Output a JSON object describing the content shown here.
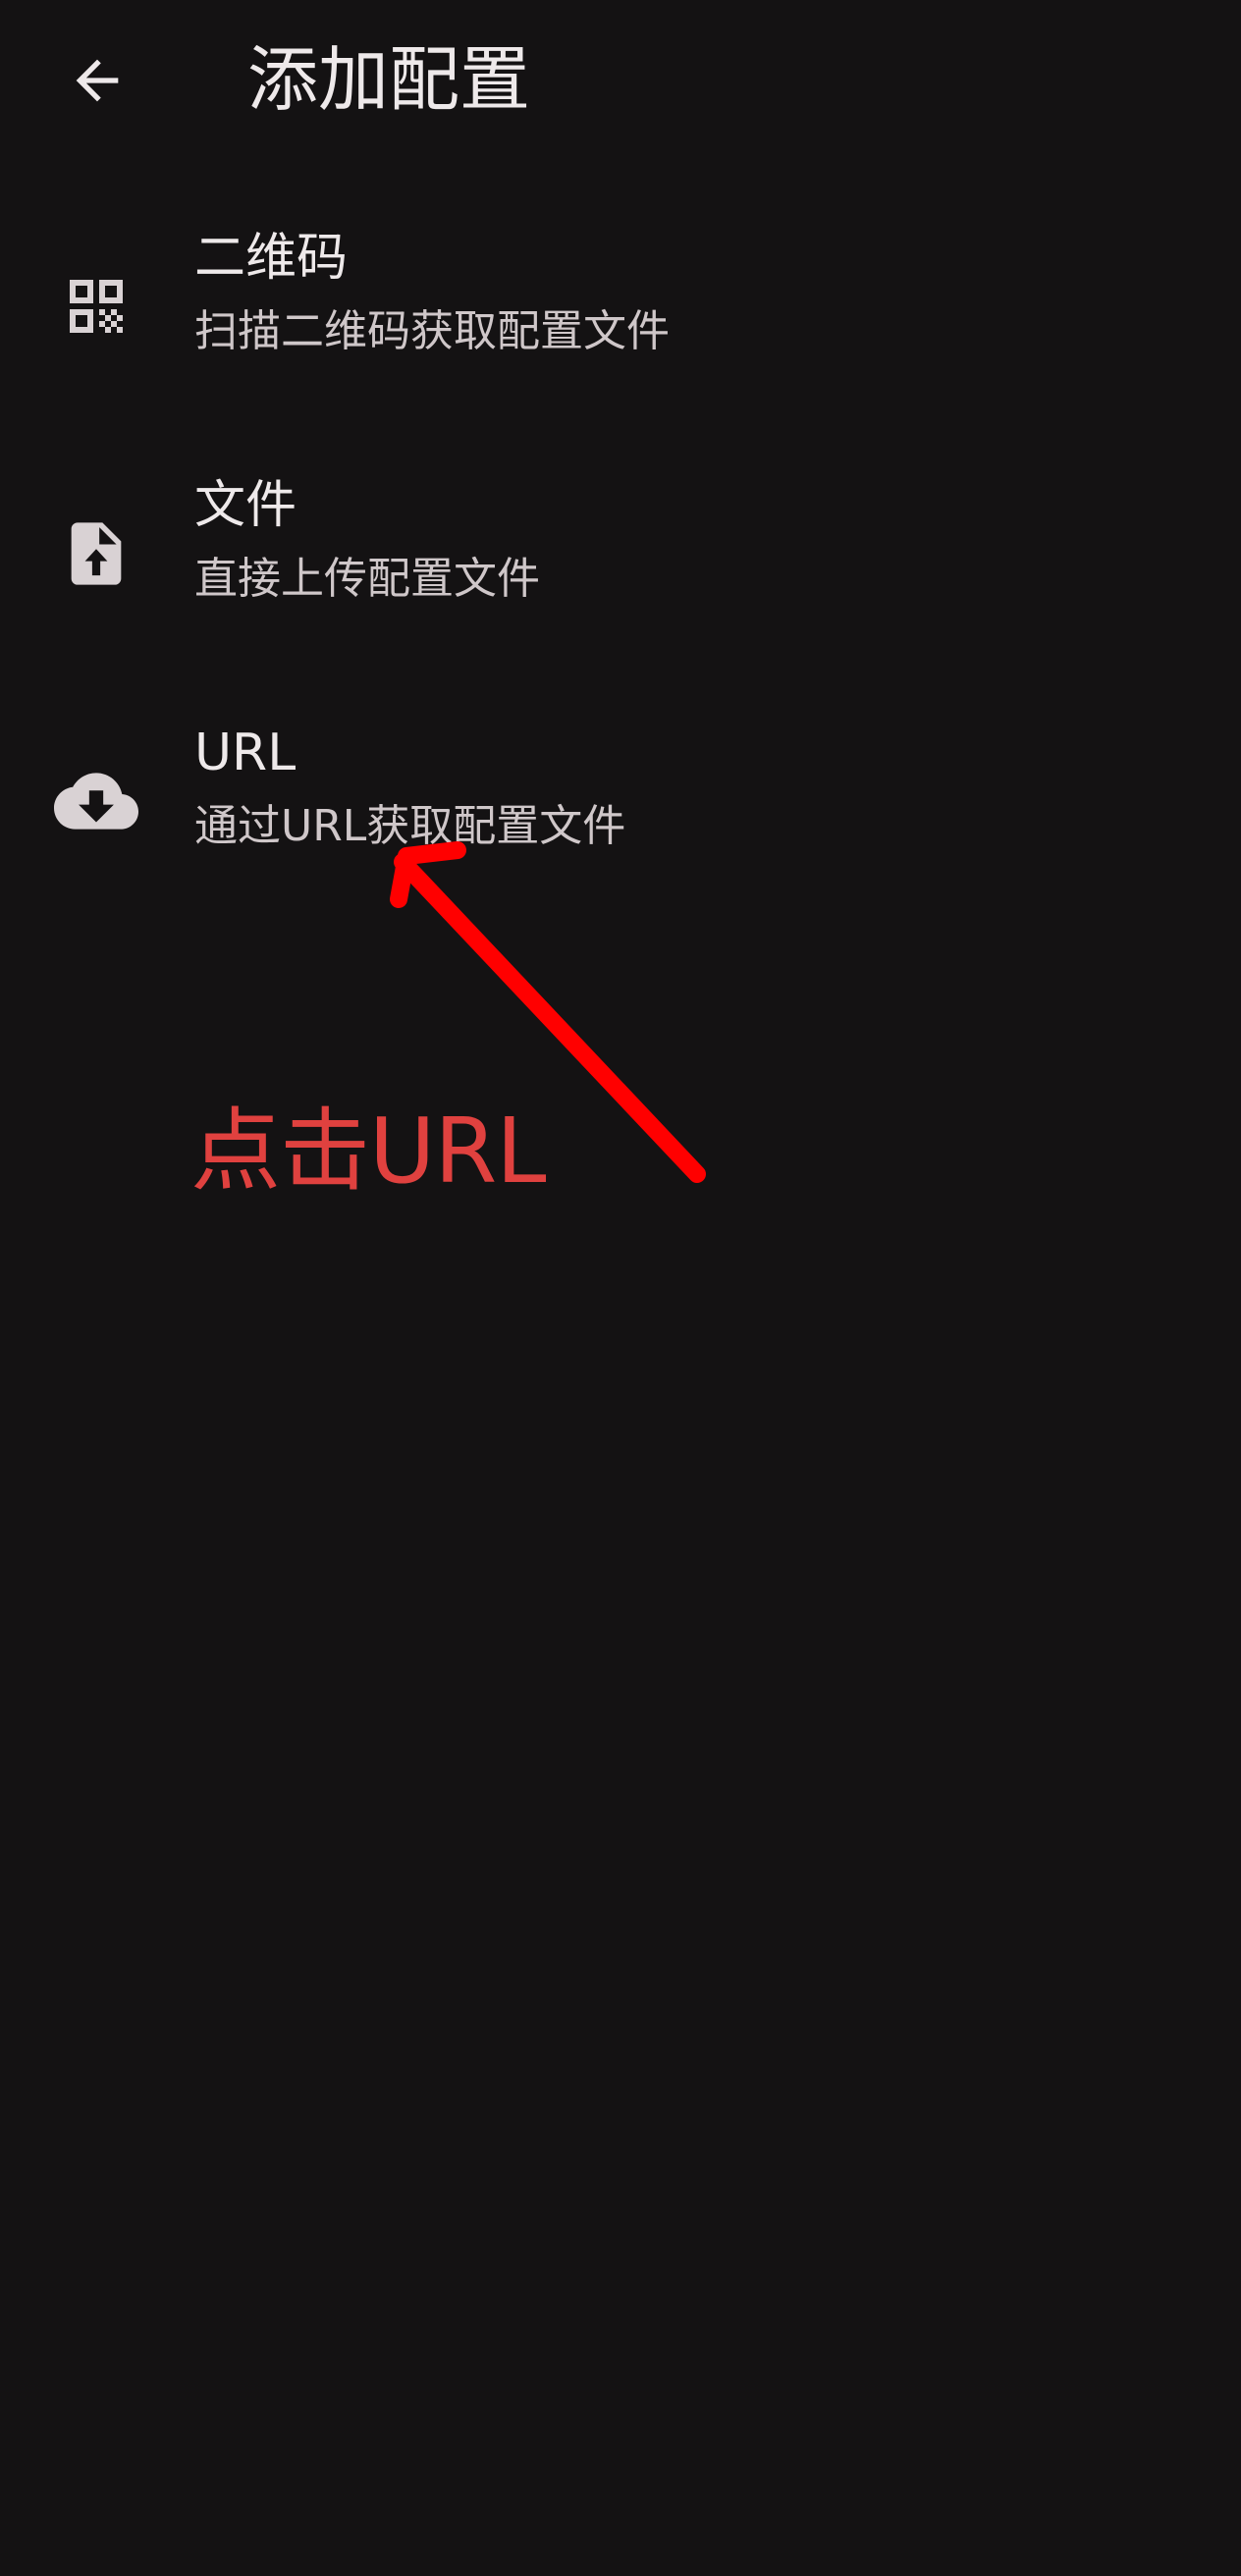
{
  "app_bar": {
    "back_icon": "arrow-back-icon",
    "title": "添加配置"
  },
  "menu": {
    "items": [
      {
        "icon": "qr-code-icon",
        "title": "二维码",
        "subtitle": "扫描二维码获取配置文件"
      },
      {
        "icon": "file-upload-icon",
        "title": "文件",
        "subtitle": "直接上传配置文件"
      },
      {
        "icon": "cloud-download-icon",
        "title": "URL",
        "subtitle": "通过URL获取配置文件"
      }
    ]
  },
  "annotation": {
    "text": "点击URL",
    "color": "#E0413F",
    "arrow_color": "#FF0000"
  },
  "colors": {
    "background": "#141213",
    "text_primary": "#EEE9EA",
    "text_secondary": "#CFC7C9",
    "icon": "#D9D2D4"
  }
}
